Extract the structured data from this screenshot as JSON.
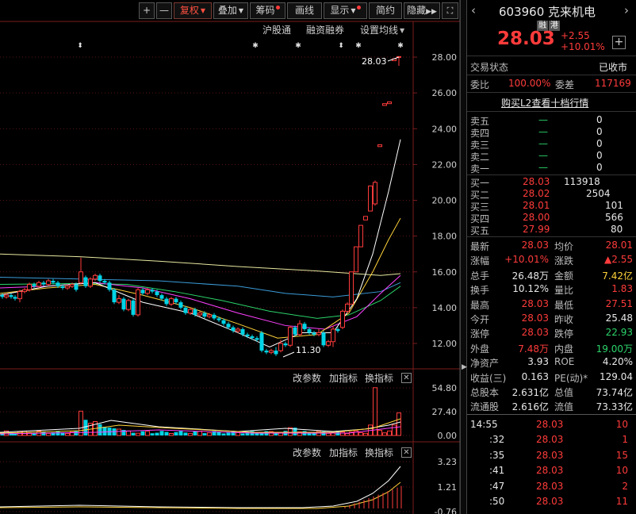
{
  "toolbar": {
    "plus": "+",
    "minus": "—",
    "fuquan": "复权",
    "diejia": "叠加",
    "chouma": "筹码",
    "huaxian": "画线",
    "xianshi": "显示",
    "jianyue": "简约",
    "yincang": "隐藏",
    "expand_icon": "expand-icon"
  },
  "subtabs": {
    "hugutong": "沪股通",
    "rongzi": "融资融券",
    "junxian": "设置均线"
  },
  "price_axis": {
    "ticks": [
      "28.00",
      "26.00",
      "24.00",
      "22.00",
      "20.00",
      "18.00",
      "16.00",
      "14.00",
      "12.00"
    ]
  },
  "annotations": {
    "high": "28.03",
    "low": "11.30"
  },
  "vol_panel": {
    "change_params": "改参数",
    "add_indicator": "加指标",
    "switch_indicator": "换指标",
    "ticks": [
      "54.80",
      "27.40",
      "0.00"
    ]
  },
  "ind_panel": {
    "change_params": "改参数",
    "add_indicator": "加指标",
    "switch_indicator": "换指标",
    "ticks": [
      "3.23",
      "1.21",
      "-0.76"
    ]
  },
  "stock": {
    "code": "603960",
    "name": "克来机电",
    "tag1": "融",
    "tag2": "港",
    "price": "28.03",
    "change": "+2.55",
    "change_pct": "+10.01%"
  },
  "status": {
    "label": "交易状态",
    "value": "已收市",
    "weibi_label": "委比",
    "weibi_value": "100.00%",
    "weicha_label": "委差",
    "weicha_value": "117169",
    "l2_link": "购买L2查看十档行情"
  },
  "asks": [
    {
      "label": "卖五",
      "price": "—",
      "vol": "0"
    },
    {
      "label": "卖四",
      "price": "—",
      "vol": "0"
    },
    {
      "label": "卖三",
      "price": "—",
      "vol": "0"
    },
    {
      "label": "卖二",
      "price": "—",
      "vol": "0"
    },
    {
      "label": "卖一",
      "price": "—",
      "vol": "0"
    }
  ],
  "bids": [
    {
      "label": "买一",
      "price": "28.03",
      "vol": "113918"
    },
    {
      "label": "买二",
      "price": "28.02",
      "vol": "2504"
    },
    {
      "label": "买三",
      "price": "28.01",
      "vol": "101"
    },
    {
      "label": "买四",
      "price": "28.00",
      "vol": "566"
    },
    {
      "label": "买五",
      "price": "27.99",
      "vol": "80"
    }
  ],
  "quote": [
    {
      "l1": "最新",
      "v1": "28.03",
      "c1": "red",
      "l2": "均价",
      "v2": "28.01",
      "c2": "red"
    },
    {
      "l1": "涨幅",
      "v1": "+10.01%",
      "c1": "red",
      "l2": "涨跌",
      "v2": "▲2.55",
      "c2": "red"
    },
    {
      "l1": "总手",
      "v1": "26.48万",
      "c1": "white",
      "l2": "金额",
      "v2": "7.42亿",
      "c2": "yellow"
    },
    {
      "l1": "换手",
      "v1": "10.12%",
      "c1": "white",
      "l2": "量比",
      "v2": "1.83",
      "c2": "red"
    },
    {
      "l1": "最高",
      "v1": "28.03",
      "c1": "red",
      "l2": "最低",
      "v2": "27.51",
      "c2": "red"
    },
    {
      "l1": "今开",
      "v1": "28.03",
      "c1": "red",
      "l2": "昨收",
      "v2": "25.48",
      "c2": "white"
    },
    {
      "l1": "涨停",
      "v1": "28.03",
      "c1": "red",
      "l2": "跌停",
      "v2": "22.93",
      "c2": "green"
    },
    {
      "l1": "外盘",
      "v1": "7.48万",
      "c1": "red",
      "l2": "内盘",
      "v2": "19.00万",
      "c2": "green"
    },
    {
      "l1": "净资产",
      "v1": "3.93",
      "c1": "white",
      "l2": "ROE",
      "v2": "4.20%",
      "c2": "white"
    },
    {
      "l1": "收益(三)",
      "v1": "0.163",
      "c1": "white",
      "l2": "PE(动)*",
      "v2": "129.04",
      "c2": "white"
    },
    {
      "l1": "总股本",
      "v1": "2.631亿",
      "c1": "white",
      "l2": "总值",
      "v2": "73.74亿",
      "c2": "white"
    },
    {
      "l1": "流通股",
      "v1": "2.616亿",
      "c1": "white",
      "l2": "流值",
      "v2": "73.33亿",
      "c2": "white"
    }
  ],
  "ticks_list": [
    {
      "time": "14:55",
      "price": "28.03",
      "vol": "10"
    },
    {
      "time": ":32",
      "price": "28.03",
      "vol": "1"
    },
    {
      "time": ":35",
      "price": "28.03",
      "vol": "15"
    },
    {
      "time": ":41",
      "price": "28.03",
      "vol": "10"
    },
    {
      "time": ":47",
      "price": "28.03",
      "vol": "2"
    },
    {
      "time": ":50",
      "price": "28.03",
      "vol": "11"
    }
  ],
  "colors": {
    "up": "#ff3b3b",
    "down": "#00d4e6",
    "ma5": "#ffffff",
    "ma10": "#ffd23a",
    "ma20": "#ff40ff",
    "ma30": "#2bd46a",
    "ma60": "#3a9bd8",
    "ma120": "#e8e8a0"
  }
}
